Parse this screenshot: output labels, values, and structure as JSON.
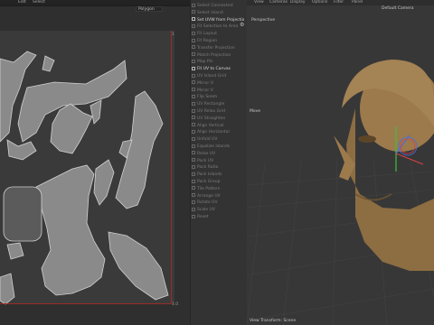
{
  "menubar": {
    "items": [
      "Edit",
      "Select"
    ]
  },
  "uv_editor": {
    "dropdown": "Polygon",
    "corner_top": "1",
    "corner_bottom": "1.0"
  },
  "panel": {
    "items": [
      {
        "label": "Select Connected",
        "hl": false
      },
      {
        "label": "Select Island",
        "hl": false
      },
      {
        "label": "Set UVW from Projection",
        "hl": true
      },
      {
        "label": "Fit Selection to Area",
        "hl": false
      },
      {
        "label": "Fit Layout",
        "hl": false
      },
      {
        "label": "Fit Region",
        "hl": false
      },
      {
        "label": "Transfer Projection",
        "hl": false
      },
      {
        "label": "Match Projection",
        "hl": false
      },
      {
        "label": "Map Pin",
        "hl": false
      },
      {
        "label": "Fit UV to Canvas",
        "hl": true
      },
      {
        "label": "UV Island Grid",
        "hl": false
      },
      {
        "label": "Mirror U",
        "hl": false
      },
      {
        "label": "Mirror V",
        "hl": false
      },
      {
        "label": "Flip Seam",
        "hl": false
      },
      {
        "label": "UV Rectangle",
        "hl": false
      },
      {
        "label": "UV Relax Grid",
        "hl": false
      },
      {
        "label": "UV Straighten",
        "hl": false
      },
      {
        "label": "Align Vertical",
        "hl": false
      },
      {
        "label": "Align Horizontal",
        "hl": false
      },
      {
        "label": "Unfold UV",
        "hl": false
      },
      {
        "label": "Equalize Islands",
        "hl": false
      },
      {
        "label": "Relax UV",
        "hl": false
      },
      {
        "label": "Pack UV",
        "hl": false
      },
      {
        "label": "Pack Ratio",
        "hl": false
      },
      {
        "label": "Pack Islands",
        "hl": false
      },
      {
        "label": "Pack Group",
        "hl": false
      },
      {
        "label": "Tile Pattern",
        "hl": false
      },
      {
        "label": "Arrange UV",
        "hl": false
      },
      {
        "label": "Rotate UV",
        "hl": false
      },
      {
        "label": "Scale UV",
        "hl": false
      },
      {
        "label": "Reset",
        "hl": false
      }
    ]
  },
  "viewport": {
    "menu": [
      "View",
      "Cameras",
      "Display",
      "Options",
      "Filter",
      "Panel"
    ],
    "perspective": "Perspective",
    "camera": "Default Camera",
    "move_label": "Move",
    "footer": "View Transform: Scene"
  },
  "colors": {
    "skin": "#9c7a4c",
    "accent_red": "#9b2a2a"
  }
}
